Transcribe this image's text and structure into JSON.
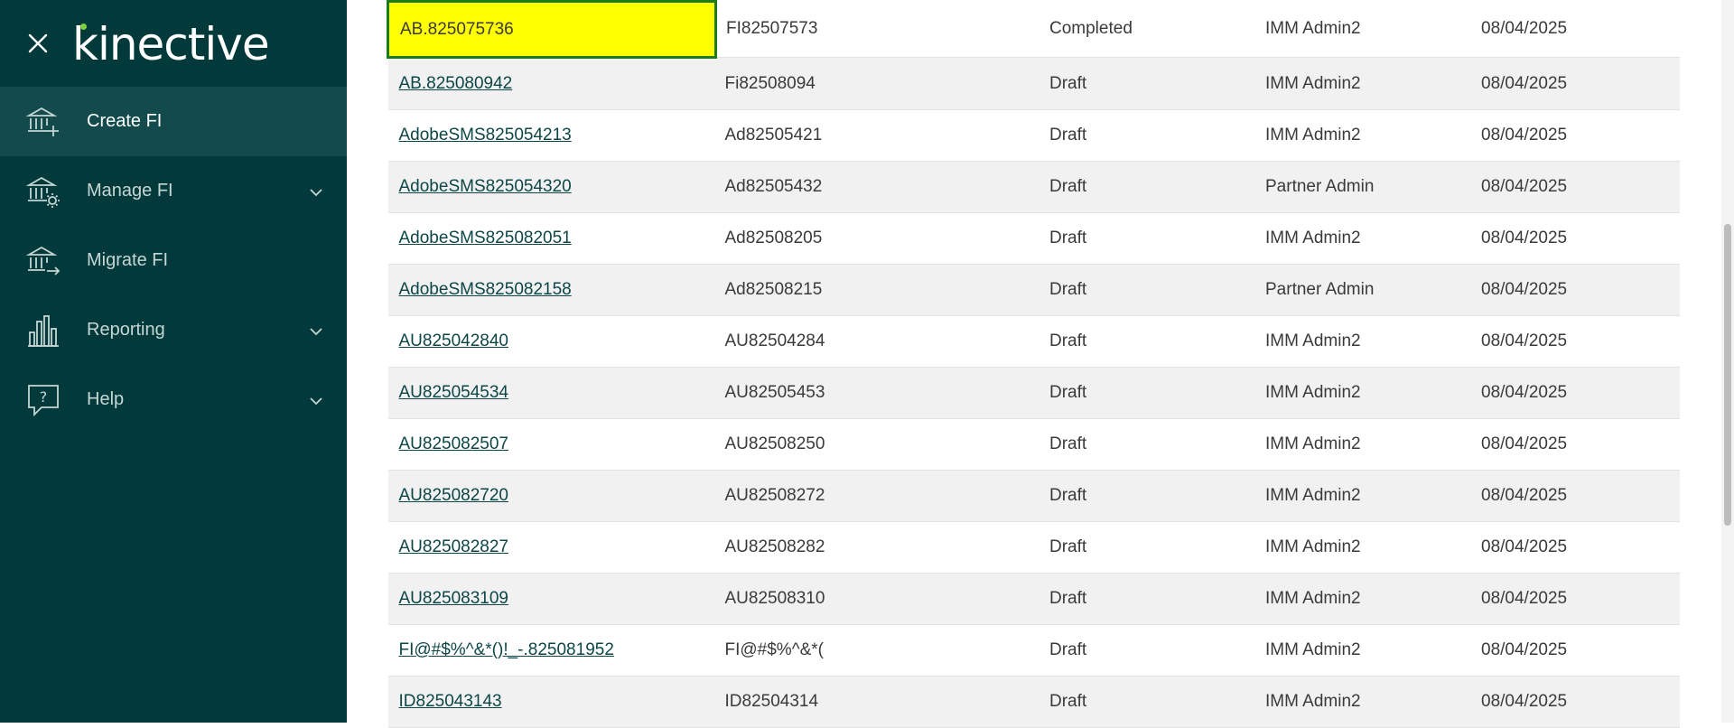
{
  "brand": {
    "logo_text": "kinective"
  },
  "sidebar": {
    "items": [
      {
        "label": "Create FI",
        "active": true,
        "has_chevron": false,
        "icon": "bank-add-icon"
      },
      {
        "label": "Manage FI",
        "active": false,
        "has_chevron": true,
        "icon": "bank-gear-icon"
      },
      {
        "label": "Migrate FI",
        "active": false,
        "has_chevron": false,
        "icon": "bank-arrow-icon"
      },
      {
        "label": "Reporting",
        "active": false,
        "has_chevron": true,
        "icon": "bar-chart-icon"
      },
      {
        "label": "Help",
        "active": false,
        "has_chevron": true,
        "icon": "help-bubble-icon"
      }
    ]
  },
  "table": {
    "rows": [
      {
        "name": "AB.825075736",
        "code": "FI82507573",
        "status": "Completed",
        "user": "IMM Admin2",
        "date": "08/04/2025",
        "highlighted": true
      },
      {
        "name": "AB.825080942",
        "code": "Fi82508094",
        "status": "Draft",
        "user": "IMM Admin2",
        "date": "08/04/2025"
      },
      {
        "name": "AdobeSMS825054213",
        "code": "Ad82505421",
        "status": "Draft",
        "user": "IMM Admin2",
        "date": "08/04/2025"
      },
      {
        "name": "AdobeSMS825054320",
        "code": "Ad82505432",
        "status": "Draft",
        "user": "Partner Admin",
        "date": "08/04/2025"
      },
      {
        "name": "AdobeSMS825082051",
        "code": "Ad82508205",
        "status": "Draft",
        "user": "IMM Admin2",
        "date": "08/04/2025"
      },
      {
        "name": "AdobeSMS825082158",
        "code": "Ad82508215",
        "status": "Draft",
        "user": "Partner Admin",
        "date": "08/04/2025"
      },
      {
        "name": "AU825042840",
        "code": "AU82504284",
        "status": "Draft",
        "user": "IMM Admin2",
        "date": "08/04/2025"
      },
      {
        "name": "AU825054534",
        "code": "AU82505453",
        "status": "Draft",
        "user": "IMM Admin2",
        "date": "08/04/2025"
      },
      {
        "name": "AU825082507",
        "code": "AU82508250",
        "status": "Draft",
        "user": "IMM Admin2",
        "date": "08/04/2025"
      },
      {
        "name": "AU825082720",
        "code": "AU82508272",
        "status": "Draft",
        "user": "IMM Admin2",
        "date": "08/04/2025"
      },
      {
        "name": "AU825082827",
        "code": "AU82508282",
        "status": "Draft",
        "user": "IMM Admin2",
        "date": "08/04/2025"
      },
      {
        "name": "AU825083109",
        "code": "AU82508310",
        "status": "Draft",
        "user": "IMM Admin2",
        "date": "08/04/2025"
      },
      {
        "name": "FI@#$%^&*()!_-.825081952",
        "code": "FI@#$%^&*(",
        "status": "Draft",
        "user": "IMM Admin2",
        "date": "08/04/2025"
      },
      {
        "name": "ID825043143",
        "code": "ID82504314",
        "status": "Draft",
        "user": "IMM Admin2",
        "date": "08/04/2025"
      }
    ]
  },
  "colors": {
    "sidebar_bg": "#023a3c",
    "active_bg": "#134b4d",
    "highlight": "#ffff00",
    "highlight_border": "#1b7a1b",
    "link": "#0d4647"
  }
}
